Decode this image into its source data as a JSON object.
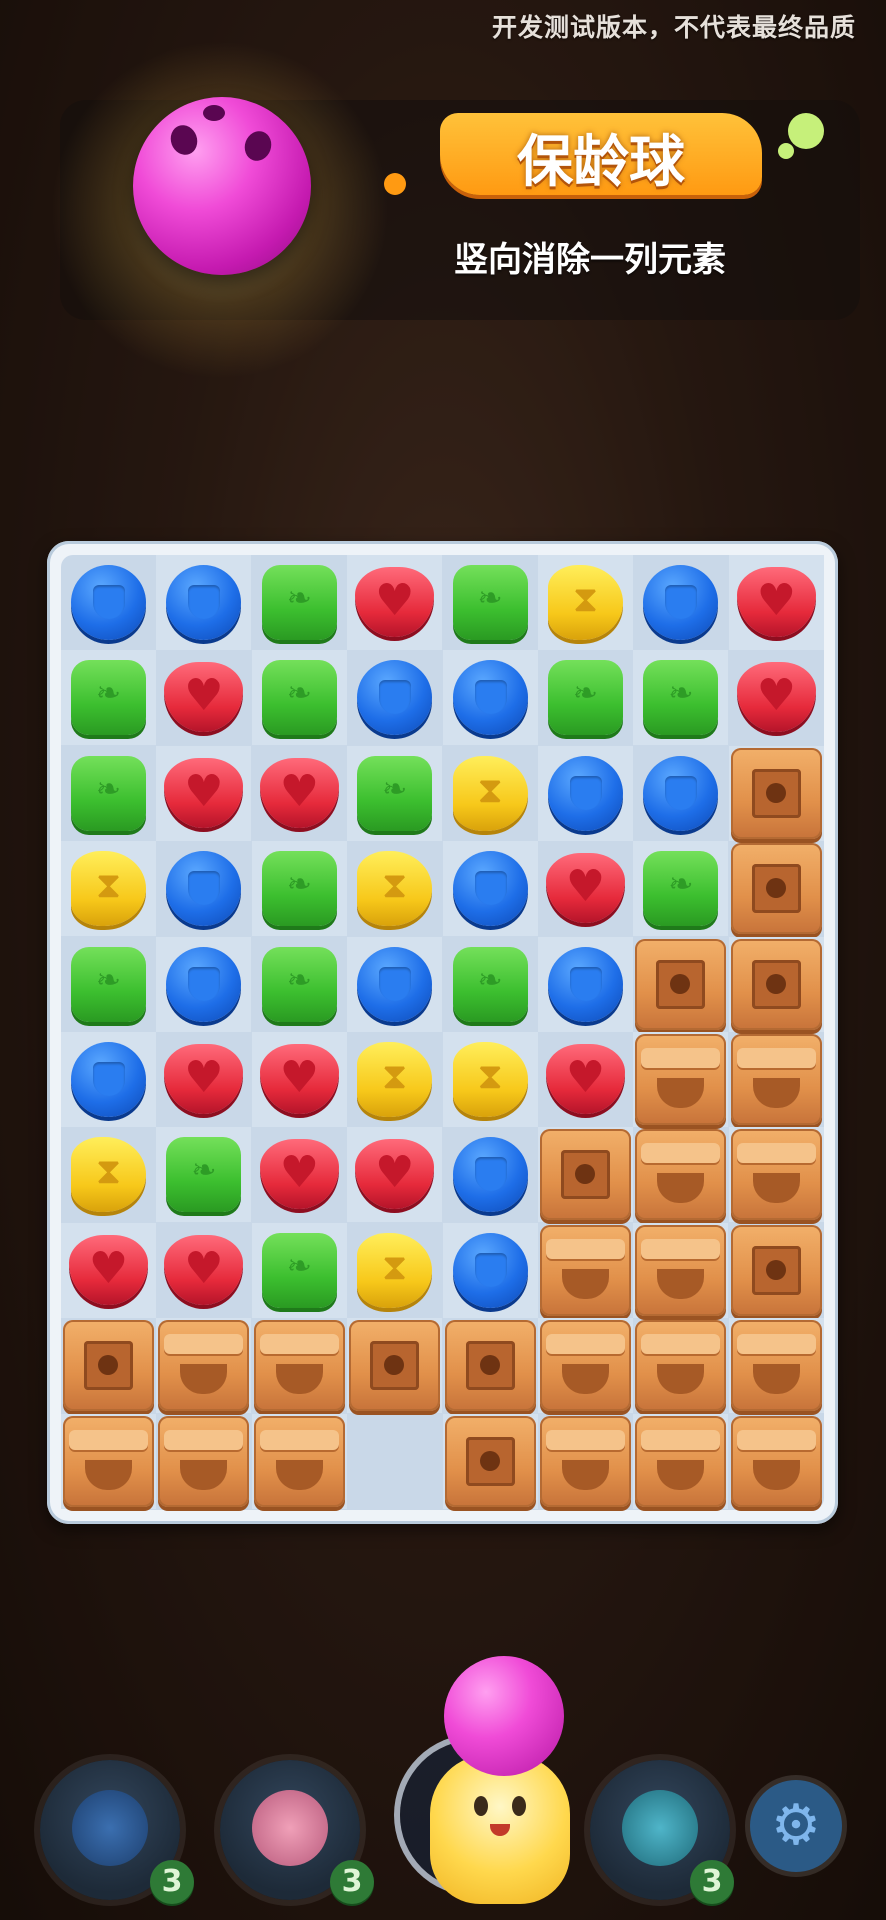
{
  "header": {
    "watermark": "开发测试版本，不代表最终品质"
  },
  "booster": {
    "title": "保龄球",
    "description": "竖向消除一列元素",
    "icon": "bowling-ball-icon"
  },
  "board": {
    "rows": 10,
    "cols": 8,
    "legend": {
      "B": "blue-gem",
      "G": "green-gem",
      "R": "red-gem",
      "Y": "yellow-gem",
      "X": "bomb-crate",
      "C": "chest-crate",
      "_": "empty"
    },
    "grid": [
      [
        "B",
        "B",
        "G",
        "R",
        "G",
        "Y",
        "B",
        "R"
      ],
      [
        "G",
        "R",
        "G",
        "B",
        "B",
        "G",
        "G",
        "R"
      ],
      [
        "G",
        "R",
        "R",
        "G",
        "Y",
        "B",
        "B",
        "X"
      ],
      [
        "Y",
        "B",
        "G",
        "Y",
        "B",
        "R",
        "G",
        "X"
      ],
      [
        "G",
        "B",
        "G",
        "B",
        "G",
        "B",
        "X",
        "X"
      ],
      [
        "B",
        "R",
        "R",
        "Y",
        "Y",
        "R",
        "C",
        "C"
      ],
      [
        "Y",
        "G",
        "R",
        "R",
        "B",
        "X",
        "C",
        "C"
      ],
      [
        "R",
        "R",
        "G",
        "Y",
        "B",
        "C",
        "C",
        "X"
      ],
      [
        "X",
        "C",
        "C",
        "X",
        "X",
        "C",
        "C",
        "C"
      ],
      [
        "C",
        "C",
        "C",
        "_",
        "X",
        "C",
        "C",
        "C"
      ]
    ],
    "colors": {
      "blue": "#1e6ee8",
      "green": "#3cbf2f",
      "red": "#e62a3b",
      "yellow": "#f7c81a",
      "crate": "#e1904a"
    }
  },
  "bottom_bar": {
    "helpers": [
      {
        "name": "helper-1",
        "count": "3"
      },
      {
        "name": "helper-2",
        "count": "3"
      },
      {
        "name": "helper-4",
        "count": "3"
      }
    ],
    "settings_icon": "gear-icon"
  }
}
